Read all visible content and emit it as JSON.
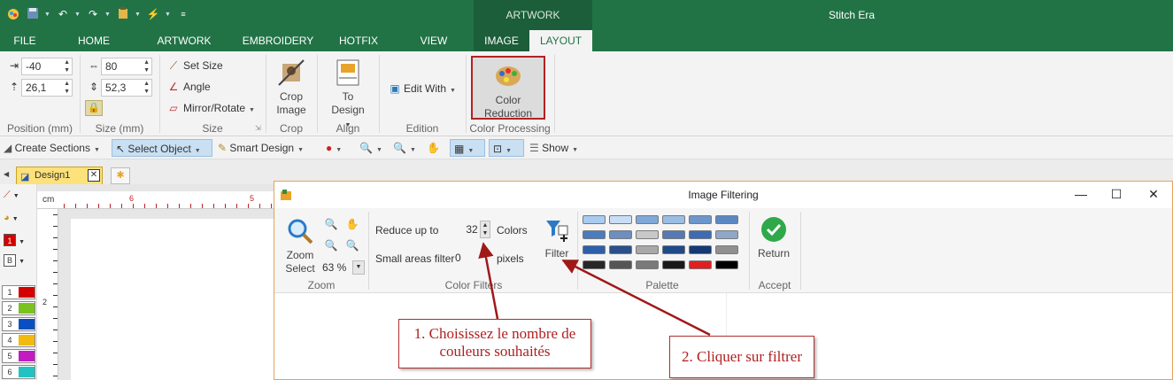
{
  "app": {
    "title": "Stitch Era",
    "context_tab_group": "ARTWORK"
  },
  "tabs": [
    {
      "label": "FILE"
    },
    {
      "label": "HOME"
    },
    {
      "label": "ARTWORK"
    },
    {
      "label": "EMBROIDERY"
    },
    {
      "label": "HOTFIX"
    },
    {
      "label": "VIEW"
    },
    {
      "label": "IMAGE"
    },
    {
      "label": "LAYOUT"
    }
  ],
  "ribbon": {
    "position": {
      "x": "-40",
      "y": "26,1",
      "label": "Position (mm)"
    },
    "size": {
      "w": "80",
      "h": "52,3",
      "label": "Size (mm)"
    },
    "size_group": {
      "set_size": "Set Size",
      "angle": "Angle",
      "mirror_rotate": "Mirror/Rotate",
      "label": "Size"
    },
    "crop": {
      "button": "Crop Image",
      "label": "Crop"
    },
    "align": {
      "button": "To Design",
      "label": "Align"
    },
    "edition": {
      "button": "Edit With",
      "label": "Edition"
    },
    "color_processing": {
      "button": "Color Reduction",
      "label": "Color Processing"
    }
  },
  "toolbar": {
    "create_sections": "Create Sections",
    "select_object": "Select Object",
    "smart_design": "Smart Design",
    "show": "Show"
  },
  "document": {
    "tab": "Design1",
    "ruler_unit": "cm",
    "ruler_top": [
      "6",
      "5"
    ],
    "ruler_left": [
      "2"
    ]
  },
  "thread_palette": [
    {
      "num": "1",
      "color": "#d40000"
    },
    {
      "num": "2",
      "color": "#7ac21d"
    },
    {
      "num": "3",
      "color": "#0a4fc2"
    },
    {
      "num": "4",
      "color": "#f2b90e"
    },
    {
      "num": "5",
      "color": "#c21bc2"
    },
    {
      "num": "6",
      "color": "#21c2c2"
    }
  ],
  "side_tools": {
    "color_box": "1",
    "border_box": "B"
  },
  "dialog": {
    "title": "Image Filtering",
    "zoom": {
      "button": "Zoom Select",
      "percent": "63 %",
      "label": "Zoom"
    },
    "filters": {
      "reduce_label": "Reduce up to",
      "reduce_value": "32",
      "reduce_unit": "Colors",
      "small_label": "Small areas filter",
      "small_value": "0",
      "small_unit": "pixels",
      "filter_button": "Filter",
      "label": "Color Filters"
    },
    "palette": {
      "label": "Palette",
      "rows": [
        [
          "#a8cbef",
          "#c9def5",
          "#7fa8d8",
          "#9bbde4",
          "#6d97cc",
          "#5b88c2"
        ],
        [
          "#4a7cc0",
          "#6a8fc0",
          "#c8c8c8",
          "#5479b5",
          "#3d6cb5",
          "#8fa8c8"
        ],
        [
          "#2f5fa8",
          "#2a4f8a",
          "#a8a8a8",
          "#1f4a8a",
          "#143a75",
          "#909090"
        ],
        [
          "#282828",
          "#555555",
          "#7a7a7a",
          "#1a1a1a",
          "#e02020",
          "#000000"
        ]
      ]
    },
    "accept": {
      "button": "Return",
      "label": "Accept"
    }
  },
  "annotations": {
    "callout1": "1. Choisissez le nombre de couleurs souhaités",
    "callout2": "2. Cliquer sur filtrer"
  }
}
